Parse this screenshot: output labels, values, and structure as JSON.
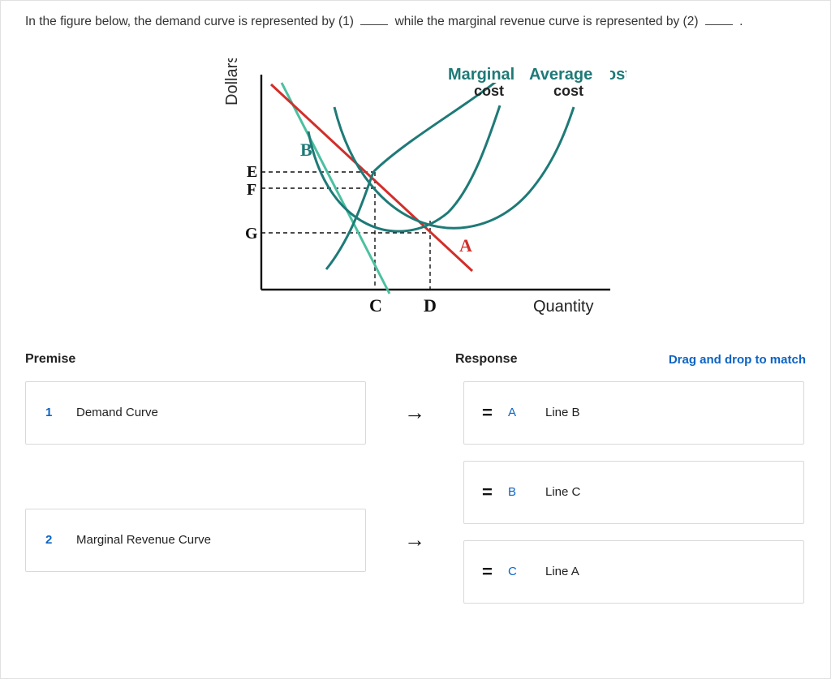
{
  "question": {
    "prefix": "In the figure below, the demand curve is represented by (1)",
    "mid": " while the marginal revenue curve is represented by (2)",
    "suffix": " ."
  },
  "chart_data": {
    "type": "line",
    "title": "",
    "xlabel": "Quantity",
    "ylabel": "Dollars",
    "y_levels": [
      "E",
      "F",
      "G"
    ],
    "x_levels": [
      "C",
      "D"
    ],
    "curves": [
      {
        "name": "A",
        "label": "A",
        "color": "#d12f2b",
        "desc": "demand (downward sloping, less steep)"
      },
      {
        "name": "B",
        "label": "B",
        "color": "#4cc0a1",
        "desc": "marginal revenue (downward sloping, steep)"
      },
      {
        "name": "MC",
        "label": "Marginal cost",
        "color": "#1e7a77",
        "desc": "U-shaped rising"
      },
      {
        "name": "AC",
        "label": "Average cost",
        "color": "#1e7a77",
        "desc": "U-shaped, right of MC"
      }
    ],
    "intersections": [
      {
        "x": "C",
        "y": "E",
        "curves": [
          "B",
          "MC"
        ]
      },
      {
        "x": "C",
        "y": "F",
        "curves": [
          "B",
          "AC"
        ]
      },
      {
        "x": "D",
        "y": "G",
        "curves": [
          "A",
          "MC"
        ]
      }
    ]
  },
  "headers": {
    "premise": "Premise",
    "response": "Response",
    "drag": "Drag and drop to match"
  },
  "premises": [
    {
      "num": "1",
      "label": "Demand Curve"
    },
    {
      "num": "2",
      "label": "Marginal Revenue Curve"
    }
  ],
  "responses": [
    {
      "letter": "A",
      "label": "Line B"
    },
    {
      "letter": "B",
      "label": "Line C"
    },
    {
      "letter": "C",
      "label": "Line A"
    }
  ],
  "icons": {
    "arrow": "→",
    "handle": "="
  }
}
